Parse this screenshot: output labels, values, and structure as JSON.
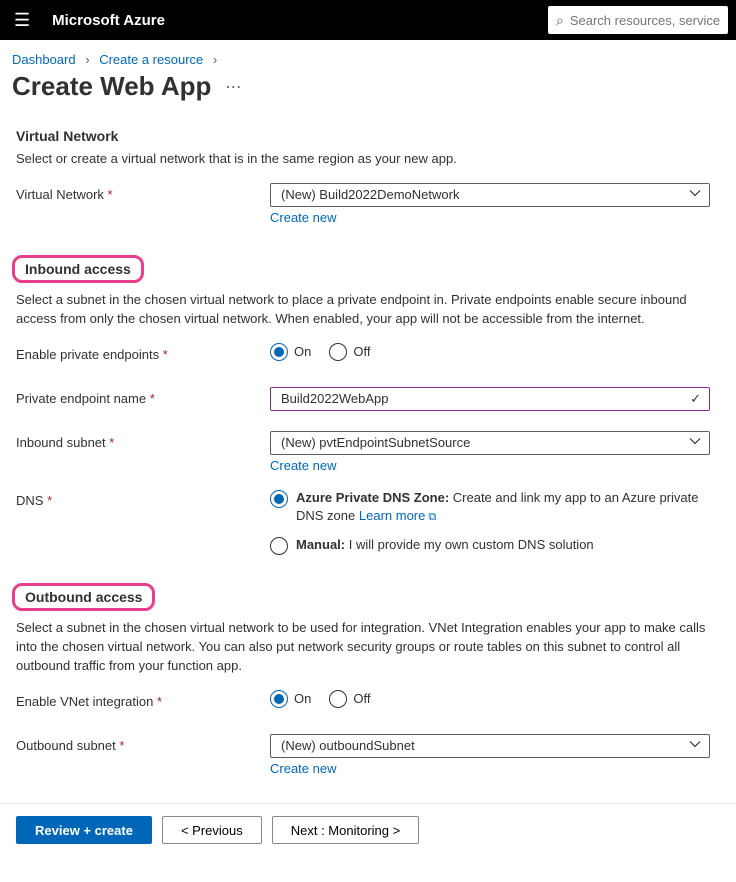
{
  "topbar": {
    "brand": "Microsoft Azure",
    "search_placeholder": "Search resources, services, and docs"
  },
  "breadcrumbs": {
    "items": [
      "Dashboard",
      "Create a resource"
    ]
  },
  "page": {
    "title": "Create Web App"
  },
  "vnet_section": {
    "heading": "Virtual Network",
    "description": "Select or create a virtual network that is in the same region as your new app.",
    "label": "Virtual Network",
    "value": "(New) Build2022DemoNetwork",
    "create_new": "Create new"
  },
  "inbound": {
    "heading": "Inbound access",
    "description": "Select a subnet in the chosen virtual network to place a private endpoint in. Private endpoints enable secure inbound access from only the chosen virtual network. When enabled, your app will not be accessible from the internet.",
    "enable_label": "Enable private endpoints",
    "on": "On",
    "off": "Off",
    "endpoint_name_label": "Private endpoint name",
    "endpoint_name_value": "Build2022WebApp",
    "subnet_label": "Inbound subnet",
    "subnet_value": "(New) pvtEndpointSubnetSource",
    "create_new": "Create new",
    "dns_label": "DNS",
    "dns_azure_title": "Azure Private DNS Zone:",
    "dns_azure_desc": " Create and link my app to an Azure private DNS zone ",
    "learn_more": "Learn more",
    "dns_manual_title": "Manual:",
    "dns_manual_desc": " I will provide my own custom DNS solution"
  },
  "outbound": {
    "heading": "Outbound access",
    "description": "Select a subnet in the chosen virtual network to be used for integration. VNet Integration enables your app to make calls into the chosen virtual network. You can also put network security groups or route tables on this subnet to control all outbound traffic from your function app.",
    "enable_label": "Enable VNet integration",
    "on": "On",
    "off": "Off",
    "subnet_label": "Outbound subnet",
    "subnet_value": "(New) outboundSubnet",
    "create_new": "Create new"
  },
  "footer": {
    "review": "Review + create",
    "previous": "< Previous",
    "next": "Next : Monitoring >"
  }
}
